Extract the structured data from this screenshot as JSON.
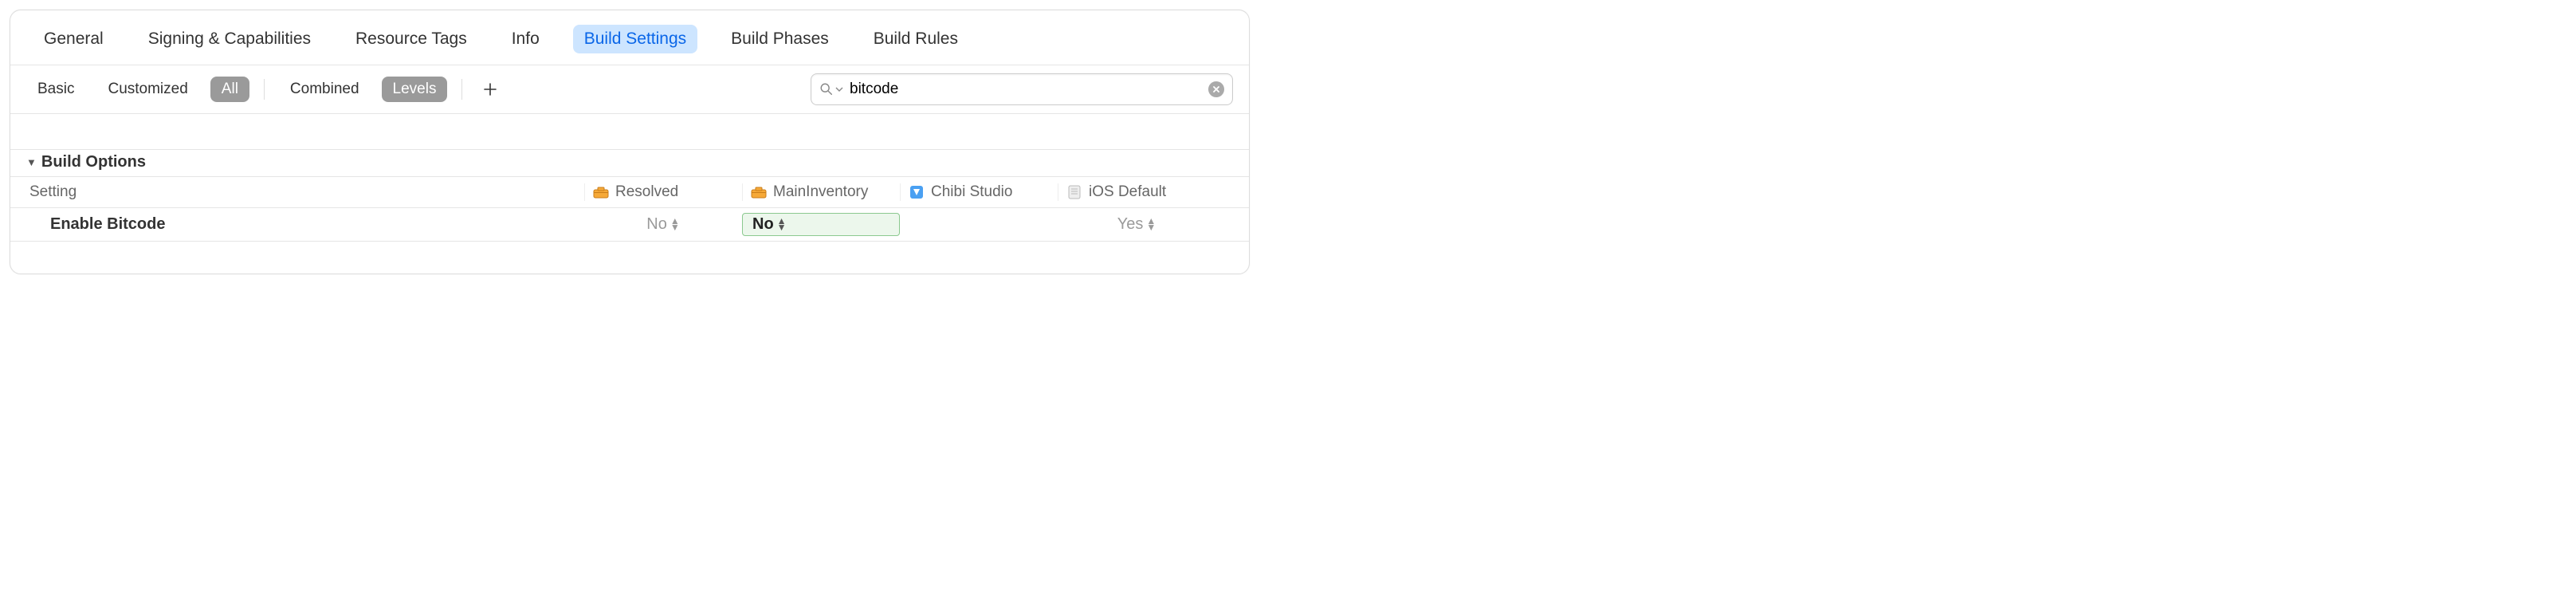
{
  "tabs": {
    "general": "General",
    "signing": "Signing & Capabilities",
    "resource_tags": "Resource Tags",
    "info": "Info",
    "build_settings": "Build Settings",
    "build_phases": "Build Phases",
    "build_rules": "Build Rules",
    "active": "build_settings"
  },
  "filter": {
    "basic": "Basic",
    "customized": "Customized",
    "all": "All",
    "combined": "Combined",
    "levels": "Levels"
  },
  "search": {
    "value": "bitcode"
  },
  "section": {
    "title": "Build Options",
    "columns": {
      "setting": "Setting",
      "resolved": "Resolved",
      "target": "MainInventory",
      "project": "Chibi Studio",
      "default": "iOS Default"
    },
    "rows": [
      {
        "name": "Enable Bitcode",
        "resolved": "No",
        "target": "No",
        "project": "",
        "default": "Yes"
      }
    ]
  }
}
